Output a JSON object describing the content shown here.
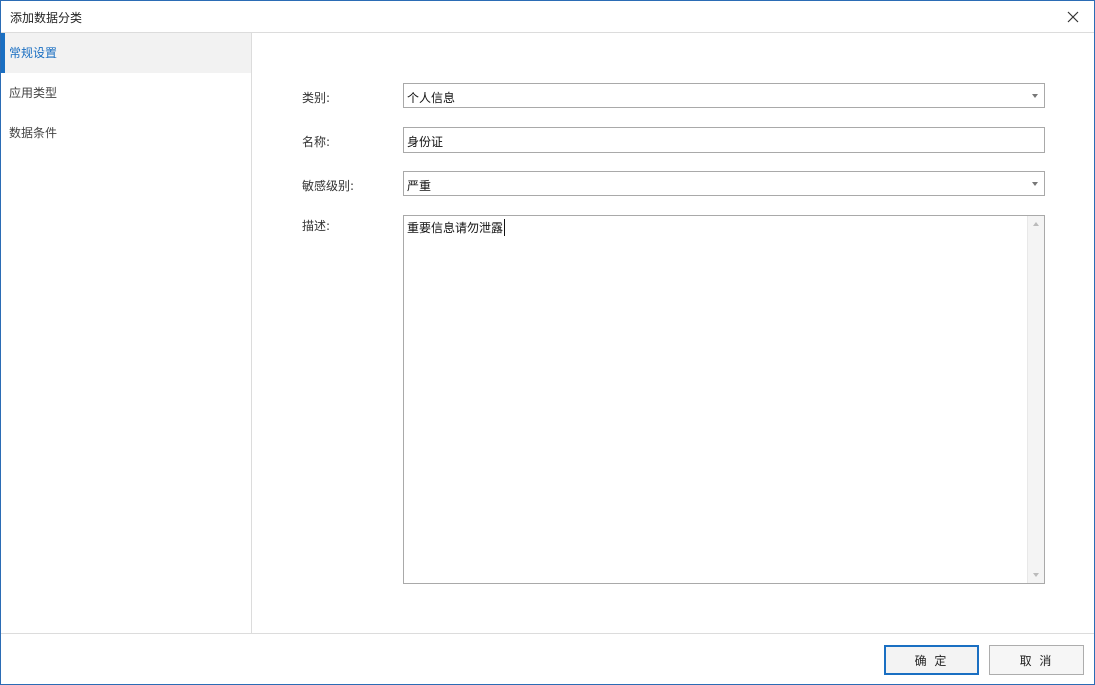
{
  "window": {
    "title": "添加数据分类",
    "close_icon": "close-icon"
  },
  "sidebar": {
    "items": [
      {
        "label": "常规设置",
        "active": true
      },
      {
        "label": "应用类型",
        "active": false
      },
      {
        "label": "数据条件",
        "active": false
      }
    ]
  },
  "form": {
    "category": {
      "label": "类别:",
      "value": "个人信息"
    },
    "name": {
      "label": "名称:",
      "value": "身份证"
    },
    "sensitivity": {
      "label": "敏感级别:",
      "value": "严重"
    },
    "description": {
      "label": "描述:",
      "value": "重要信息请勿泄露"
    }
  },
  "footer": {
    "ok_label": "确 定",
    "cancel_label": "取 消"
  },
  "colors": {
    "accent": "#1a6fc2",
    "border": "#a9a9a9"
  }
}
